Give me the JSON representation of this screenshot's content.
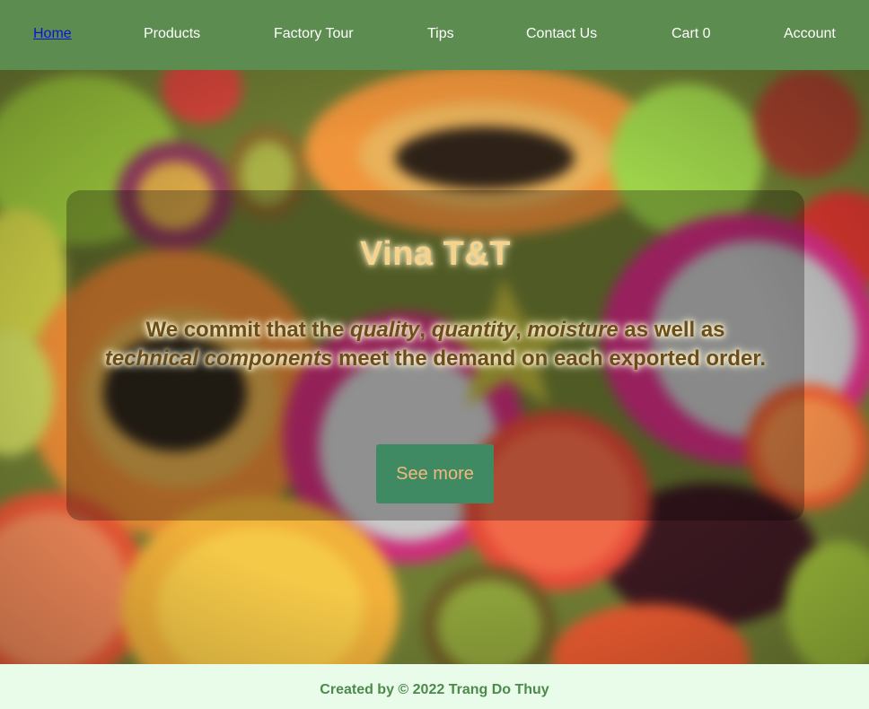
{
  "nav": {
    "home": "Home",
    "products": "Products",
    "factory_tour": "Factory Tour",
    "tips": "Tips",
    "contact": "Contact Us",
    "cart": "Cart 0",
    "account": "Account"
  },
  "hero": {
    "brand": "Vina T&T",
    "tagline": {
      "p1": "We commit that the ",
      "quality": "quality",
      "c1": ", ",
      "quantity": "quantity",
      "c2": ", ",
      "moisture": "moisture",
      "p2": " as well as ",
      "technical": "technical components",
      "p3": " meet the demand on each exported order."
    },
    "button": "See more"
  },
  "footer": {
    "text": "Created by © 2022 Trang Do Thuy"
  },
  "colors": {
    "nav_bg": "#5d8c50",
    "nav_active": "#0b13d6",
    "brand": "#f5d38c",
    "button_bg": "#3f8a62",
    "button_text": "#f1b97b",
    "footer_bg": "#e9fbe9",
    "footer_text": "#4c8a4c"
  },
  "icons": {
    "hero_background": "fruit-background-image"
  }
}
